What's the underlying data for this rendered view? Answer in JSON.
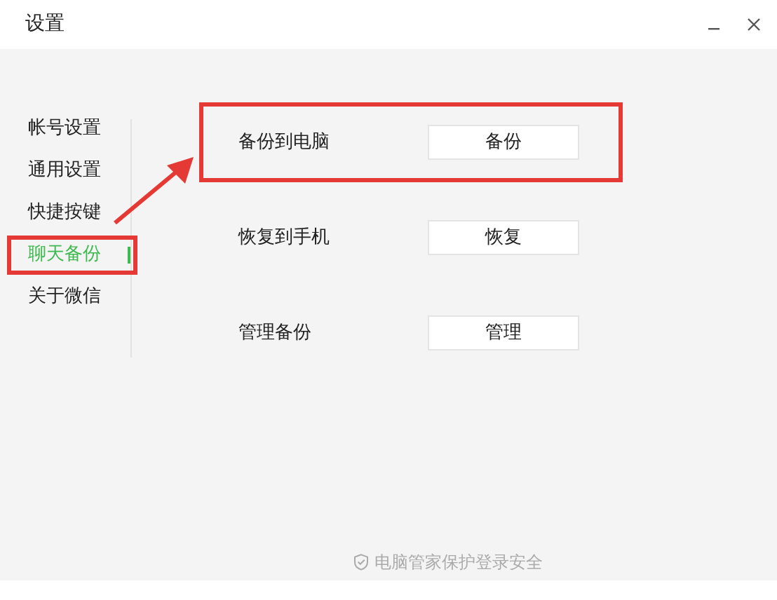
{
  "window": {
    "title": "设置"
  },
  "sidebar": {
    "items": [
      {
        "label": "帐号设置",
        "selected": false
      },
      {
        "label": "通用设置",
        "selected": false
      },
      {
        "label": "快捷按键",
        "selected": false
      },
      {
        "label": "聊天备份",
        "selected": true
      },
      {
        "label": "关于微信",
        "selected": false
      }
    ]
  },
  "rows": [
    {
      "label": "备份到电脑",
      "button": "备份",
      "highlighted": true
    },
    {
      "label": "恢复到手机",
      "button": "恢复",
      "highlighted": false
    },
    {
      "label": "管理备份",
      "button": "管理",
      "highlighted": false
    }
  ],
  "footer": {
    "text": "电脑管家保护登录安全"
  }
}
